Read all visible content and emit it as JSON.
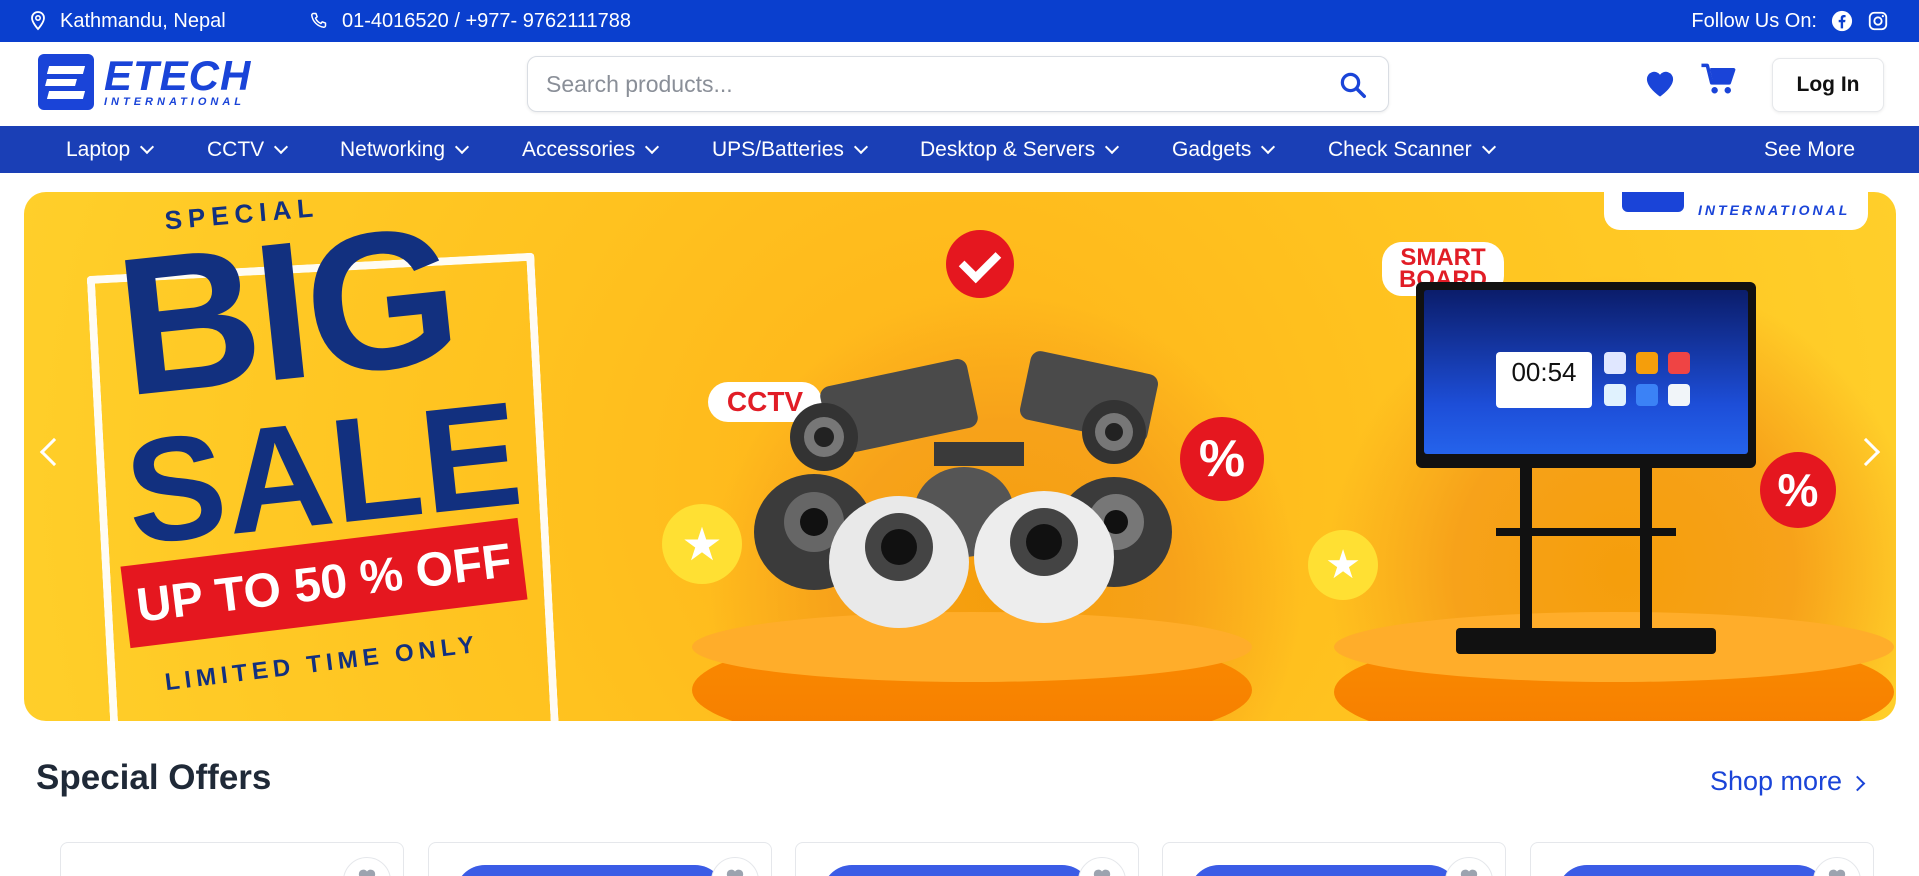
{
  "topbar": {
    "location": "Kathmandu, Nepal",
    "phone": "01-4016520 / +977- 9762111788",
    "follow_label": "Follow Us On:",
    "icons": [
      "location-pin-icon",
      "phone-icon",
      "facebook-icon",
      "instagram-icon"
    ],
    "color": "#0a3fce"
  },
  "header": {
    "logo_main": "ETECH",
    "logo_sub": "INTERNATIONAL",
    "search_placeholder": "Search products...",
    "login_label": "Log In",
    "icons": [
      "search-icon",
      "heart-icon",
      "cart-icon"
    ],
    "accent": "#1a44d8"
  },
  "nav": {
    "items": [
      {
        "label": "Laptop"
      },
      {
        "label": "CCTV"
      },
      {
        "label": "Networking"
      },
      {
        "label": "Accessories"
      },
      {
        "label": "UPS/Batteries"
      },
      {
        "label": "Desktop & Servers"
      },
      {
        "label": "Gadgets"
      },
      {
        "label": "Check Scanner"
      }
    ],
    "see_more": "See More",
    "color": "#1a3fb6"
  },
  "banner": {
    "special": "SPECIAL",
    "big": "BIG",
    "sale": "SALE",
    "offer": "UP TO 50 % OFF",
    "limited": "LIMITED TIME ONLY",
    "cctv_tag": "CCTV",
    "smart_line1": "SMART",
    "smart_line2": "BOARD",
    "clock": "00:54",
    "percent": "%",
    "corner_logo_text": "INTERNATIONAL"
  },
  "special_offers": {
    "title": "Special Offers",
    "shop_more": "Shop more"
  }
}
